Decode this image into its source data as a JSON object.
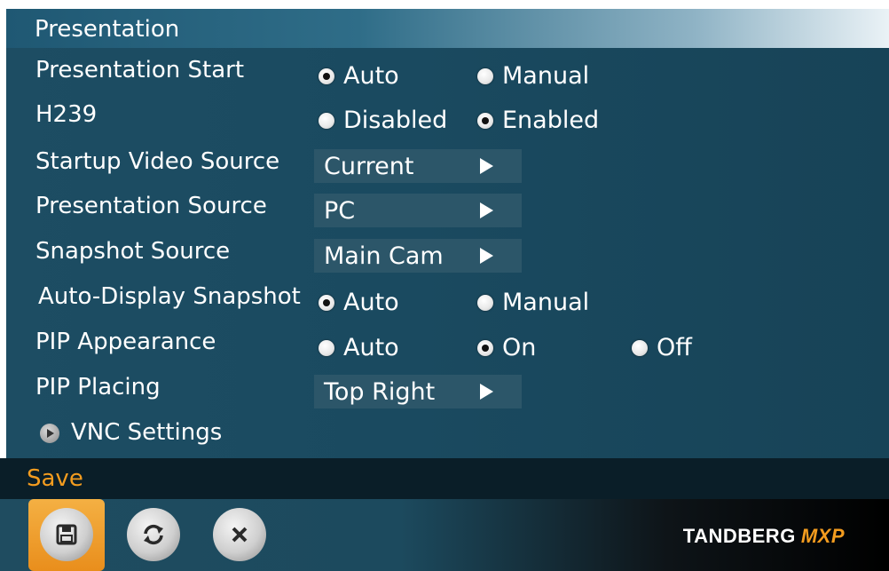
{
  "window": {
    "title": "Presentation"
  },
  "settings": {
    "presentation_start": {
      "label": "Presentation Start",
      "options": [
        "Auto",
        "Manual"
      ],
      "selected": "Auto"
    },
    "h239": {
      "label": "H239",
      "options": [
        "Disabled",
        "Enabled"
      ],
      "selected": "Enabled"
    },
    "startup_video_source": {
      "label": "Startup Video Source",
      "value": "Current"
    },
    "presentation_source": {
      "label": "Presentation Source",
      "value": "PC"
    },
    "snapshot_source": {
      "label": "Snapshot Source",
      "value": "Main Cam"
    },
    "auto_display_snapshot": {
      "label": "Auto-Display Snapshot",
      "options": [
        "Auto",
        "Manual"
      ],
      "selected": "Auto"
    },
    "pip_appearance": {
      "label": "PIP Appearance",
      "options": [
        "Auto",
        "On",
        "Off"
      ],
      "selected": "On"
    },
    "pip_placing": {
      "label": "PIP Placing",
      "value": "Top Right"
    },
    "vnc_settings": {
      "label": "VNC Settings"
    }
  },
  "footer": {
    "save_label": "Save",
    "buttons": [
      "save-icon",
      "refresh-icon",
      "cancel-icon"
    ],
    "brand": "TANDBERG",
    "brand_suffix": "MXP"
  },
  "colors": {
    "accent": "#f39c1f",
    "panel": "#1d4d63",
    "select_bg": "#2c5669"
  }
}
